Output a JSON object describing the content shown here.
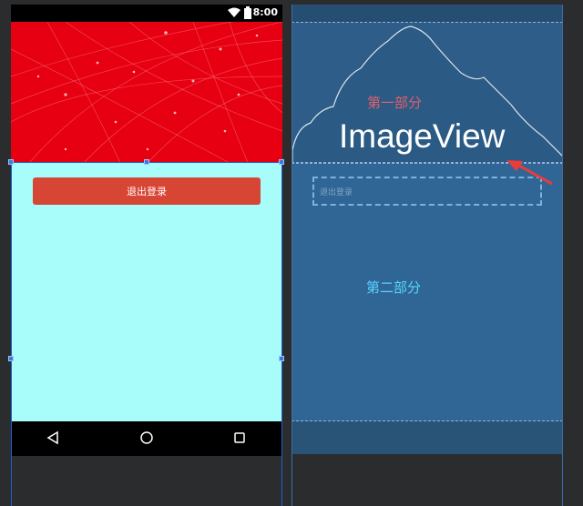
{
  "status_bar": {
    "time": "8:00"
  },
  "content": {
    "logout_label": "退出登录"
  },
  "blueprint": {
    "part1_label": "第一部分",
    "imageview_label": "ImageView",
    "part2_label": "第二部分",
    "button_label": "退出登录"
  },
  "colors": {
    "hero_red": "#e60012",
    "content_cyan": "#a8fdfb",
    "button_red": "#d74534",
    "blueprint_bg": "#2a5378"
  },
  "icons": [
    "wifi-icon",
    "battery-icon",
    "back-icon",
    "home-icon",
    "recent-apps-icon",
    "arrow-icon"
  ]
}
